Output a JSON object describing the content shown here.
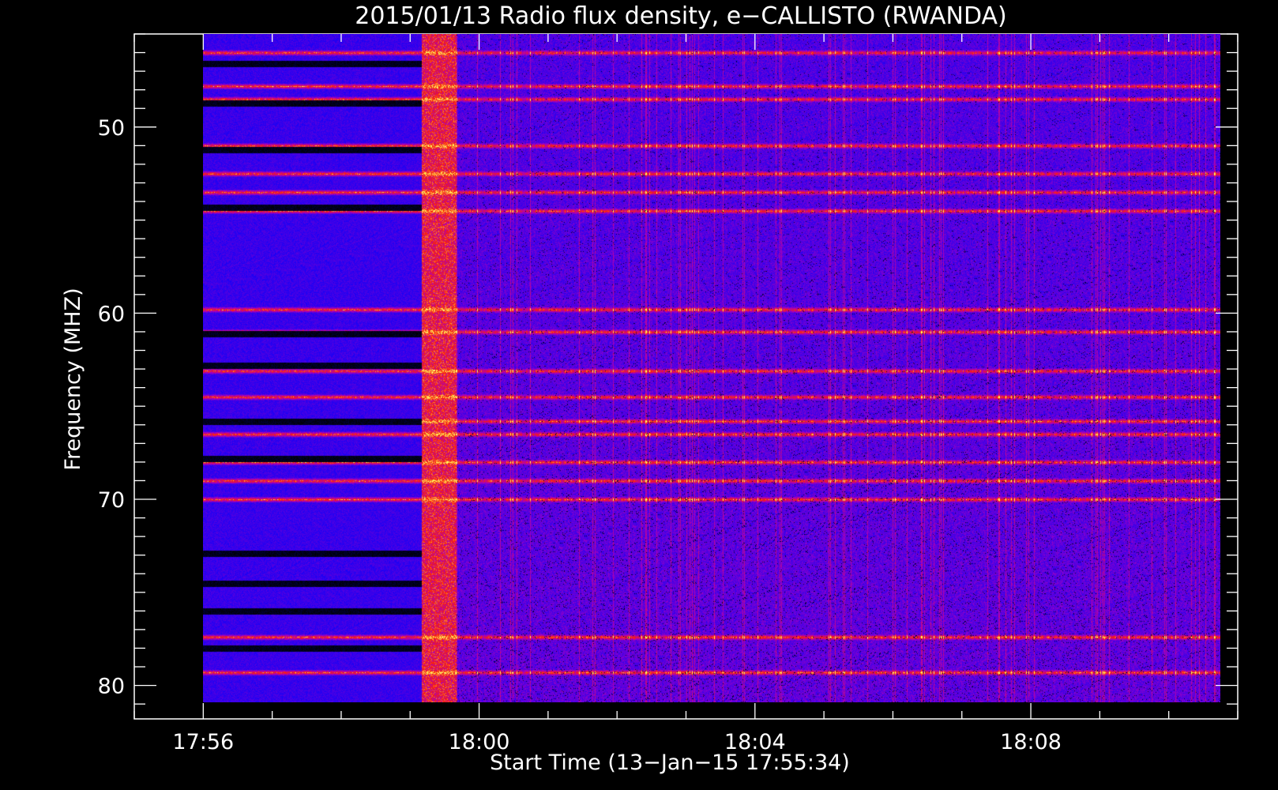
{
  "chart_data": {
    "type": "heatmap",
    "title": "2015/01/13  Radio flux density, e−CALLISTO (RWANDA)",
    "xlabel": "Start Time (13−Jan−15 17:55:34)",
    "ylabel": "Frequency (MHZ)",
    "x_ticks": [
      "17:56",
      "18:00",
      "18:04",
      "18:08"
    ],
    "y_ticks": [
      "50",
      "60",
      "70",
      "80"
    ],
    "x_range": [
      "17:55",
      "18:11"
    ],
    "y_range": [
      45,
      81.8
    ],
    "y_inverted": true,
    "data_time_range": [
      "17:56",
      "18:10:45"
    ],
    "data_freq_range": [
      45,
      80.9
    ],
    "colormap": "black-blue-red-yellow",
    "colors": {
      "background": "#000000",
      "low": "#0000ff",
      "mid": "#ff0000",
      "high": "#ffff00",
      "axes": "#ffffff"
    },
    "burst_window": [
      "17:59:10",
      "17:59:40"
    ],
    "strong_lines_mhz": [
      46,
      47.8,
      48.5,
      51,
      52.5,
      53.5,
      54.5,
      59.8,
      61,
      63.1,
      64.5,
      65.8,
      66.5,
      68,
      69,
      70,
      77.4,
      79.3
    ],
    "gap_lines_mhz": [
      46.6,
      48.7,
      51.2,
      54.3,
      61.1,
      62.8,
      65.8,
      67.8,
      72.9,
      74.5,
      76,
      78
    ]
  }
}
